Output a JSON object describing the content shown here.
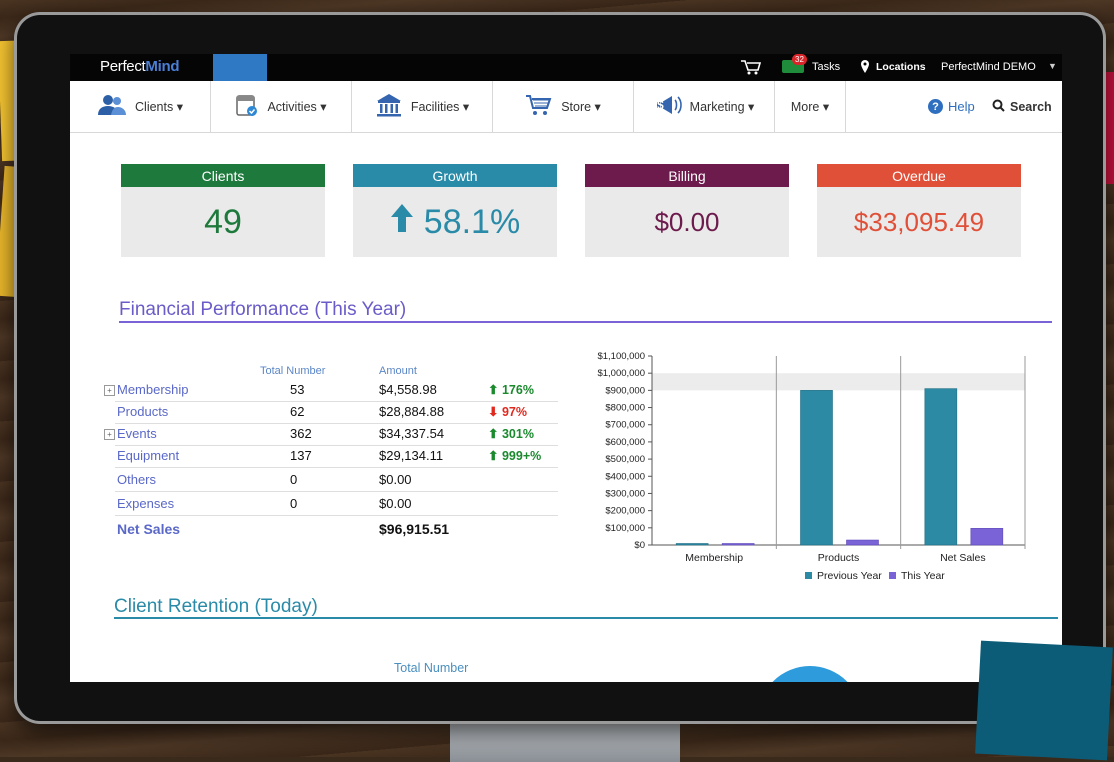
{
  "app": {
    "logo_part1": "Perfect",
    "logo_part2": "Mind"
  },
  "topbar": {
    "tasks_badge": "32",
    "tasks_label": "Tasks",
    "locations_label": "Locations",
    "account_label": "PerfectMind DEMO"
  },
  "nav": {
    "items": [
      {
        "label": "Clients ▾",
        "icon": "users-icon"
      },
      {
        "label": "Activities ▾",
        "icon": "calendar-check-icon"
      },
      {
        "label": "Facilities ▾",
        "icon": "building-icon"
      },
      {
        "label": "Store ▾",
        "icon": "cart-icon"
      },
      {
        "label": "Marketing ▾",
        "icon": "megaphone-icon"
      },
      {
        "label": "More ▾",
        "icon": ""
      }
    ],
    "help_label": "Help",
    "search_label": "Search"
  },
  "kpis": [
    {
      "title": "Clients",
      "value": "49",
      "header_color": "#1e7a3c",
      "value_color": "#1e7a3c"
    },
    {
      "title": "Growth",
      "value": "58.1%",
      "header_color": "#2a8ba8",
      "value_color": "#2a8ba8"
    },
    {
      "title": "Billing",
      "value": "$0.00",
      "header_color": "#6d1a4c",
      "value_color": "#6d1a4c"
    },
    {
      "title": "Overdue",
      "value": "$33,095.49",
      "header_color": "#e05038",
      "value_color": "#e05038"
    }
  ],
  "financial": {
    "title": "Financial Performance (This Year)",
    "col_total": "Total Number",
    "col_amount": "Amount",
    "rows": [
      {
        "label": "Membership",
        "expandable": true,
        "total": "53",
        "amount": "$4,558.98",
        "change": "176%",
        "direction": "up"
      },
      {
        "label": "Products",
        "expandable": false,
        "total": "62",
        "amount": "$28,884.88",
        "change": "97%",
        "direction": "down"
      },
      {
        "label": "Events",
        "expandable": true,
        "total": "362",
        "amount": "$34,337.54",
        "change": "301%",
        "direction": "up"
      },
      {
        "label": "Equipment",
        "expandable": false,
        "total": "137",
        "amount": "$29,134.11",
        "change": "999+%",
        "direction": "up"
      },
      {
        "label": "Others",
        "expandable": false,
        "total": "0",
        "amount": "$0.00",
        "change": "",
        "direction": ""
      },
      {
        "label": "Expenses",
        "expandable": false,
        "total": "0",
        "amount": "$0.00",
        "change": "",
        "direction": ""
      }
    ],
    "net_label": "Net Sales",
    "net_amount": "$96,915.51"
  },
  "chart_data": {
    "type": "bar",
    "categories": [
      "Membership",
      "Products",
      "Net Sales"
    ],
    "series": [
      {
        "name": "Previous Year",
        "values": [
          1000,
          900000,
          910000
        ],
        "color": "#2c8aa5"
      },
      {
        "name": "This Year",
        "values": [
          4559,
          28885,
          96916
        ],
        "color": "#7a63d6"
      }
    ],
    "ylim": [
      0,
      1100000
    ],
    "yticks": [
      "$0",
      "$100,000",
      "$200,000",
      "$300,000",
      "$400,000",
      "$500,000",
      "$600,000",
      "$700,000",
      "$800,000",
      "$900,000",
      "$1,000,000",
      "$1,100,000"
    ],
    "legend": "bottom",
    "grid": true
  },
  "retention": {
    "title": "Client Retention (Today)",
    "col_total": "Total Number"
  },
  "colors": {
    "purple_accent": "#7a63d6",
    "teal_accent": "#2a8ba8",
    "link_blue": "#5a68c8"
  }
}
